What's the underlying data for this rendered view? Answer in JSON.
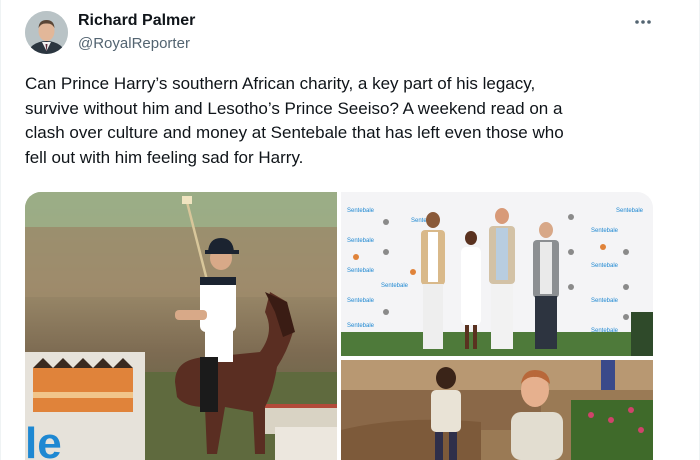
{
  "author": {
    "name": "Richard Palmer",
    "handle": "@RoyalReporter"
  },
  "tweet": {
    "text": "Can Prince Harry’s southern African charity, a key part of his legacy,\nsurvive without him and Lesotho’s Prince Seeiso? A weekend read on a\nclash over culture and money at Sentebale that has left even those who\nfell out with him feeling sad for Harry."
  },
  "media": {
    "backdrop_brand": "Sentebale",
    "banner_letters": "le"
  },
  "icons": {
    "more": "more-dots-icon"
  },
  "colors": {
    "name_text": "#0f1419",
    "handle_text": "#536471",
    "sentebale_blue": "#1e88d2"
  }
}
